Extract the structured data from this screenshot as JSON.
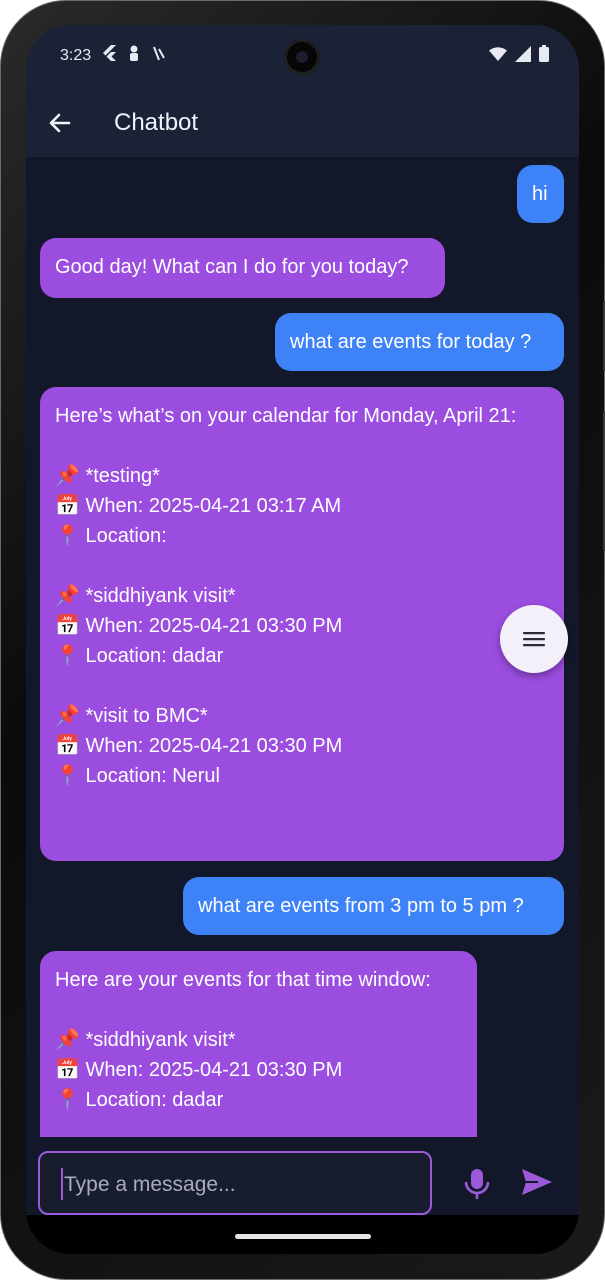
{
  "status": {
    "time": "3:23",
    "left_icons": [
      "flutter-icon",
      "person-icon",
      "notification-icon"
    ],
    "right_icons": [
      "wifi-icon",
      "signal-icon",
      "battery-icon"
    ]
  },
  "appbar": {
    "title": "Chatbot"
  },
  "messages": [
    {
      "role": "user",
      "text": "hi"
    },
    {
      "role": "bot",
      "text": "Good day! What can I do for you today?"
    },
    {
      "role": "user",
      "text": "what are events for today ?"
    },
    {
      "role": "bot",
      "text": "Here’s what’s on your calendar for Monday, April 21:\n\n📌 *testing*\n📅 When: 2025-04-21 03:17 AM\n📍 Location: \n\n📌 *siddhiyank visit*\n📅 When: 2025-04-21 03:30 PM\n📍 Location: dadar\n\n📌 *visit to BMC*\n📅 When: 2025-04-21 03:30 PM\n📍 Location: Nerul\n"
    },
    {
      "role": "user",
      "text": "what are events from 3 pm to 5 pm ?"
    },
    {
      "role": "bot",
      "text": "Here are your events for that time window:\n\n📌 *siddhiyank visit*\n📅 When: 2025-04-21 03:30 PM\n📍 Location: dadar\n"
    }
  ],
  "fab": {
    "icon": "menu-icon"
  },
  "input": {
    "placeholder": "Type a message...",
    "value": ""
  },
  "colors": {
    "background": "#121829",
    "appbar": "#1b2236",
    "user_bubble": "#3d82f6",
    "bot_bubble": "#9b4de0",
    "accent": "#9b5ad9"
  }
}
